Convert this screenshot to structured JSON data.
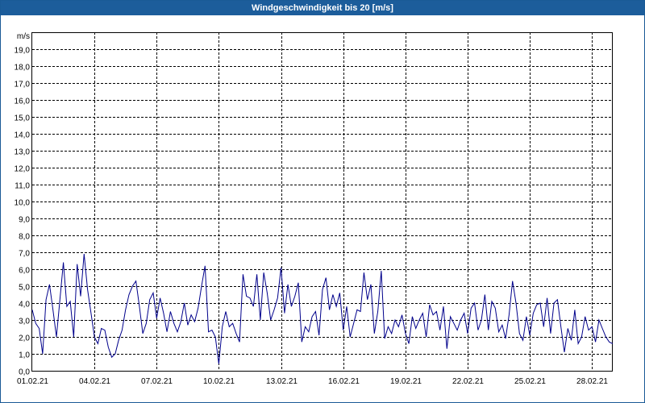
{
  "window": {
    "title": "Windgeschwindigkeit bis 20 [m/s]"
  },
  "chart_data": {
    "type": "line",
    "title": "Windgeschwindigkeit bis 20 [m/s]",
    "ylabel": "m/s",
    "xlabel": "",
    "ylim": [
      0,
      20
    ],
    "xlim": [
      "2021-02-01",
      "2021-03-01"
    ],
    "grid": true,
    "y_ticks": [
      "0,0",
      "1,0",
      "2,0",
      "3,0",
      "4,0",
      "5,0",
      "6,0",
      "7,0",
      "8,0",
      "9,0",
      "10,0",
      "11,0",
      "12,0",
      "13,0",
      "14,0",
      "15,0",
      "16,0",
      "17,0",
      "18,0",
      "19,0"
    ],
    "x_ticks": [
      "01.02.21",
      "04.02.21",
      "07.02.21",
      "10.02.21",
      "13.02.21",
      "16.02.21",
      "19.02.21",
      "22.02.21",
      "25.02.21",
      "28.02.21"
    ],
    "x_tick_dates": [
      "2021-02-01",
      "2021-02-04",
      "2021-02-07",
      "2021-02-10",
      "2021-02-13",
      "2021-02-16",
      "2021-02-19",
      "2021-02-22",
      "2021-02-25",
      "2021-02-28"
    ],
    "line_color": "#00008b",
    "series": [
      {
        "x": [
          "2021-02-01 00:00",
          "2021-02-01 04:00",
          "2021-02-01 08:00",
          "2021-02-01 12:00",
          "2021-02-01 16:00",
          "2021-02-01 20:00",
          "2021-02-02 00:00",
          "2021-02-02 04:00",
          "2021-02-02 08:00",
          "2021-02-02 12:00",
          "2021-02-02 16:00",
          "2021-02-02 20:00",
          "2021-02-03 00:00",
          "2021-02-03 04:00",
          "2021-02-03 08:00",
          "2021-02-03 12:00",
          "2021-02-03 16:00",
          "2021-02-03 20:00",
          "2021-02-04 00:00",
          "2021-02-04 04:00",
          "2021-02-04 08:00",
          "2021-02-04 12:00",
          "2021-02-04 16:00",
          "2021-02-04 20:00",
          "2021-02-05 00:00",
          "2021-02-05 04:00",
          "2021-02-05 08:00",
          "2021-02-05 12:00",
          "2021-02-05 16:00",
          "2021-02-05 20:00",
          "2021-02-06 00:00",
          "2021-02-06 04:00",
          "2021-02-06 08:00",
          "2021-02-06 12:00",
          "2021-02-06 16:00",
          "2021-02-06 20:00",
          "2021-02-07 00:00",
          "2021-02-07 04:00",
          "2021-02-07 08:00",
          "2021-02-07 12:00",
          "2021-02-07 16:00",
          "2021-02-07 20:00",
          "2021-02-08 00:00",
          "2021-02-08 04:00",
          "2021-02-08 08:00",
          "2021-02-08 12:00",
          "2021-02-08 16:00",
          "2021-02-08 20:00",
          "2021-02-09 00:00",
          "2021-02-09 04:00",
          "2021-02-09 08:00",
          "2021-02-09 12:00",
          "2021-02-09 16:00",
          "2021-02-09 20:00",
          "2021-02-10 00:00",
          "2021-02-10 04:00",
          "2021-02-10 08:00",
          "2021-02-10 12:00",
          "2021-02-10 16:00",
          "2021-02-10 20:00",
          "2021-02-11 00:00",
          "2021-02-11 04:00",
          "2021-02-11 08:00",
          "2021-02-11 12:00",
          "2021-02-11 16:00",
          "2021-02-11 20:00",
          "2021-02-12 00:00",
          "2021-02-12 04:00",
          "2021-02-12 08:00",
          "2021-02-12 12:00",
          "2021-02-12 16:00",
          "2021-02-12 20:00",
          "2021-02-13 00:00",
          "2021-02-13 04:00",
          "2021-02-13 08:00",
          "2021-02-13 12:00",
          "2021-02-13 16:00",
          "2021-02-13 20:00",
          "2021-02-14 00:00",
          "2021-02-14 04:00",
          "2021-02-14 08:00",
          "2021-02-14 12:00",
          "2021-02-14 16:00",
          "2021-02-14 20:00",
          "2021-02-15 00:00",
          "2021-02-15 04:00",
          "2021-02-15 08:00",
          "2021-02-15 12:00",
          "2021-02-15 16:00",
          "2021-02-15 20:00",
          "2021-02-16 00:00",
          "2021-02-16 04:00",
          "2021-02-16 08:00",
          "2021-02-16 12:00",
          "2021-02-16 16:00",
          "2021-02-16 20:00",
          "2021-02-17 00:00",
          "2021-02-17 04:00",
          "2021-02-17 08:00",
          "2021-02-17 12:00",
          "2021-02-17 16:00",
          "2021-02-17 20:00",
          "2021-02-18 00:00",
          "2021-02-18 04:00",
          "2021-02-18 08:00",
          "2021-02-18 12:00",
          "2021-02-18 16:00",
          "2021-02-18 20:00",
          "2021-02-19 00:00",
          "2021-02-19 04:00",
          "2021-02-19 08:00",
          "2021-02-19 12:00",
          "2021-02-19 16:00",
          "2021-02-19 20:00",
          "2021-02-20 00:00",
          "2021-02-20 04:00",
          "2021-02-20 08:00",
          "2021-02-20 12:00",
          "2021-02-20 16:00",
          "2021-02-20 20:00",
          "2021-02-21 00:00",
          "2021-02-21 04:00",
          "2021-02-21 08:00",
          "2021-02-21 12:00",
          "2021-02-21 16:00",
          "2021-02-21 20:00",
          "2021-02-22 00:00",
          "2021-02-22 04:00",
          "2021-02-22 08:00",
          "2021-02-22 12:00",
          "2021-02-22 16:00",
          "2021-02-22 20:00",
          "2021-02-23 00:00",
          "2021-02-23 04:00",
          "2021-02-23 08:00",
          "2021-02-23 12:00",
          "2021-02-23 16:00",
          "2021-02-23 20:00",
          "2021-02-24 00:00",
          "2021-02-24 04:00",
          "2021-02-24 08:00",
          "2021-02-24 12:00",
          "2021-02-24 16:00",
          "2021-02-24 20:00",
          "2021-02-25 00:00",
          "2021-02-25 04:00",
          "2021-02-25 08:00",
          "2021-02-25 12:00",
          "2021-02-25 16:00",
          "2021-02-25 20:00",
          "2021-02-26 00:00",
          "2021-02-26 04:00",
          "2021-02-26 08:00",
          "2021-02-26 12:00",
          "2021-02-26 16:00",
          "2021-02-26 20:00",
          "2021-02-27 00:00",
          "2021-02-27 04:00",
          "2021-02-27 08:00",
          "2021-02-27 12:00",
          "2021-02-27 16:00",
          "2021-02-27 20:00",
          "2021-02-28 00:00",
          "2021-02-28 04:00",
          "2021-02-28 08:00",
          "2021-02-28 12:00",
          "2021-02-28 16:00",
          "2021-02-28 20:00",
          "2021-03-01 00:00"
        ],
        "y": [
          3.6,
          2.8,
          2.5,
          1.0,
          4.2,
          5.1,
          3.6,
          2.0,
          4.2,
          6.4,
          3.8,
          4.1,
          2.0,
          6.3,
          4.4,
          6.9,
          4.8,
          3.4,
          2.0,
          1.6,
          2.5,
          2.4,
          1.4,
          0.8,
          1.0,
          1.8,
          2.4,
          3.6,
          4.5,
          5.0,
          5.3,
          3.8,
          2.2,
          2.8,
          4.2,
          4.6,
          3.1,
          4.3,
          3.4,
          2.3,
          3.5,
          2.8,
          2.3,
          2.9,
          4.0,
          2.7,
          3.3,
          2.9,
          3.7,
          5.0,
          6.2,
          2.3,
          2.4,
          2.0,
          0.4,
          2.6,
          3.5,
          2.6,
          2.8,
          2.2,
          1.7,
          5.7,
          4.4,
          4.3,
          3.8,
          5.7,
          3.0,
          5.8,
          4.6,
          3.0,
          3.6,
          4.3,
          6.1,
          3.4,
          5.1,
          3.8,
          4.4,
          5.2,
          1.7,
          2.6,
          2.3,
          3.2,
          3.5,
          2.1,
          4.8,
          5.5,
          3.6,
          4.5,
          3.8,
          4.6,
          2.4,
          3.8,
          2.0,
          2.8,
          3.6,
          3.5,
          5.8,
          4.2,
          5.1,
          2.2,
          3.5,
          5.9,
          1.9,
          2.6,
          2.2,
          3.0,
          2.6,
          3.3,
          2.2,
          1.6,
          3.2,
          2.5,
          3.0,
          3.4,
          2.0,
          3.9,
          3.3,
          3.5,
          2.4,
          3.8,
          1.3,
          3.2,
          2.8,
          2.4,
          3.0,
          3.4,
          2.2,
          3.7,
          4.0,
          2.4,
          3.0,
          4.5,
          2.4,
          4.1,
          3.7,
          2.3,
          2.7,
          1.9,
          3.3,
          5.3,
          4.0,
          2.2,
          1.8,
          3.2,
          2.1,
          3.4,
          3.9,
          4.0,
          2.6,
          4.3,
          2.2,
          4.0,
          4.2,
          2.6,
          1.1,
          2.5,
          1.8,
          3.6,
          1.6,
          2.0,
          3.2,
          2.4,
          2.6,
          1.7,
          3.0,
          2.5,
          2.0,
          1.7,
          1.6
        ]
      }
    ]
  }
}
